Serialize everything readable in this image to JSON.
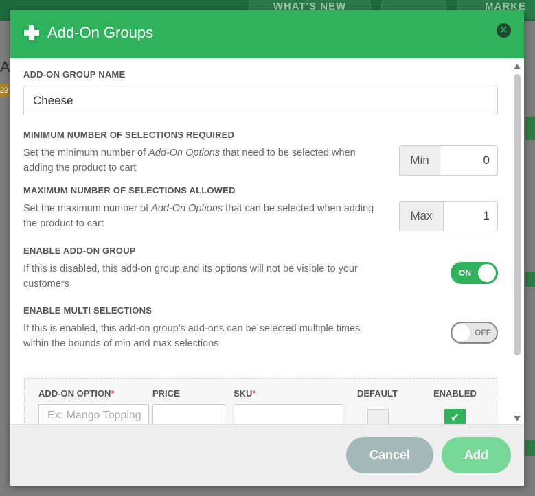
{
  "background": {
    "whats_new": "WHAT'S NEW",
    "market": "MARKE"
  },
  "modal": {
    "title": "Add-On Groups",
    "icons": {
      "header": "plus-icon",
      "close": "close-circle-icon"
    },
    "group_name": {
      "label": "ADD-ON GROUP NAME",
      "value": "Cheese"
    },
    "min_selections": {
      "label": "MINIMUM NUMBER OF SELECTIONS REQUIRED",
      "desc_before": "Set the minimum number of ",
      "desc_em": "Add-On Options",
      "desc_after": " that need to be selected when adding the product to cart",
      "addon": "Min",
      "value": "0"
    },
    "max_selections": {
      "label": "MAXIMUM NUMBER OF SELECTIONS ALLOWED",
      "desc_before": "Set the maximum number of ",
      "desc_em": "Add-On Options",
      "desc_after": " that can be selected when adding the product to cart",
      "addon": "Max",
      "value": "1"
    },
    "enable_group": {
      "label": "ENABLE ADD-ON GROUP",
      "desc": "If this is disabled, this add-on group and its options will not be visible to your customers",
      "toggle_label": "ON",
      "enabled": true
    },
    "multi_selections": {
      "label": "ENABLE MULTI SELECTIONS",
      "desc": "If this is enabled, this add-on group's add-ons can be selected multiple times within the bounds of min and max selections",
      "toggle_label": "OFF",
      "enabled": false
    },
    "options_table": {
      "headers": {
        "option": "ADD-ON OPTION",
        "price": "PRICE",
        "sku": "SKU",
        "default": "DEFAULT",
        "enabled": "ENABLED"
      },
      "required_mark": "*",
      "option_placeholder": "Ex: Mango Topping",
      "price_value": "",
      "sku_value": "",
      "default_checked": false,
      "enabled_checked": true
    },
    "footer": {
      "cancel": "Cancel",
      "add": "Add"
    }
  },
  "colors": {
    "primary": "#2fb25b",
    "cancel": "#a3b9b8",
    "add_disabled": "#78d89a"
  }
}
